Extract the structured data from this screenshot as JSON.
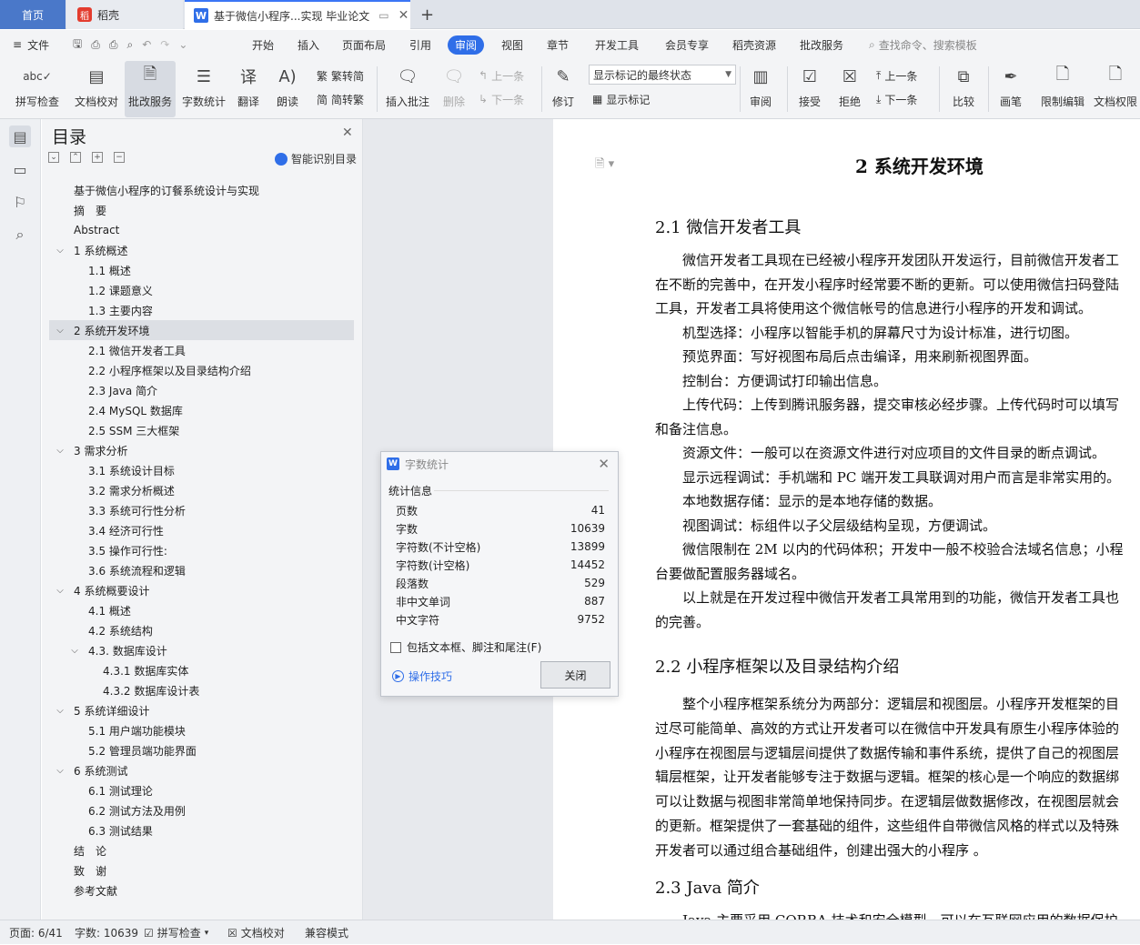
{
  "tabs": {
    "home": "首页",
    "draft": "稻壳",
    "doc": "基于微信小程序...实现 毕业论文",
    "new": "+"
  },
  "menu": {
    "file": "文件",
    "items": [
      "开始",
      "插入",
      "页面布局",
      "引用",
      "审阅",
      "视图",
      "章节",
      "开发工具",
      "会员专享",
      "稻壳资源",
      "批改服务"
    ],
    "active": "审阅",
    "search": "查找命令、搜索模板"
  },
  "ribbon": {
    "spell": "拼写检查",
    "proof": "文档校对",
    "correct": "批改服务",
    "wordcount": "字数统计",
    "translate": "翻译",
    "read": "朗读",
    "trad": "繁转简",
    "simp": "简转繁",
    "insert_comment": "插入批注",
    "delete": "删除",
    "prev": "上一条",
    "next": "下一条",
    "revise": "修订",
    "markup_select": "显示标记的最终状态",
    "show_markup": "显示标记",
    "review": "审阅",
    "accept": "接受",
    "reject": "拒绝",
    "prev2": "上一条",
    "next2": "下一条",
    "compare": "比较",
    "pen": "画笔",
    "restrict": "限制编辑",
    "rights": "文档权限"
  },
  "toc": {
    "title": "目录",
    "smart": "智能识别目录",
    "items": [
      {
        "text": "基于微信小程序的订餐系统设计与实现",
        "level": 0,
        "arrow": ""
      },
      {
        "text": "摘　要",
        "level": 0,
        "arrow": ""
      },
      {
        "text": "Abstract",
        "level": 0,
        "arrow": ""
      },
      {
        "text": "1  系统概述",
        "level": 0,
        "arrow": "v"
      },
      {
        "text": "1.1  概述",
        "level": 1,
        "arrow": ""
      },
      {
        "text": "1.2 课题意义",
        "level": 1,
        "arrow": ""
      },
      {
        "text": "1.3  主要内容",
        "level": 1,
        "arrow": ""
      },
      {
        "text": "2  系统开发环境",
        "level": 0,
        "arrow": "v"
      },
      {
        "text": "2.1 微信开发者工具",
        "level": 1,
        "arrow": ""
      },
      {
        "text": "2.2 小程序框架以及目录结构介绍",
        "level": 1,
        "arrow": ""
      },
      {
        "text": "2.3 Java 简介",
        "level": 1,
        "arrow": ""
      },
      {
        "text": "2.4 MySQL 数据库",
        "level": 1,
        "arrow": ""
      },
      {
        "text": "2.5 SSM 三大框架",
        "level": 1,
        "arrow": ""
      },
      {
        "text": "3  需求分析",
        "level": 0,
        "arrow": "v"
      },
      {
        "text": "3.1  系统设计目标",
        "level": 1,
        "arrow": ""
      },
      {
        "text": "3.2 需求分析概述",
        "level": 1,
        "arrow": ""
      },
      {
        "text": "3.3  系统可行性分析",
        "level": 1,
        "arrow": ""
      },
      {
        "text": "3.4 经济可行性",
        "level": 1,
        "arrow": ""
      },
      {
        "text": "3.5 操作可行性:",
        "level": 1,
        "arrow": ""
      },
      {
        "text": "3.6 系统流程和逻辑",
        "level": 1,
        "arrow": ""
      },
      {
        "text": "4 系统概要设计",
        "level": 0,
        "arrow": "v"
      },
      {
        "text": "4.1  概述",
        "level": 1,
        "arrow": ""
      },
      {
        "text": "4.2  系统结构",
        "level": 1,
        "arrow": ""
      },
      {
        "text": "4.3.  数据库设计",
        "level": 1,
        "arrow": "v"
      },
      {
        "text": "4.3.1  数据库实体",
        "level": 2,
        "arrow": ""
      },
      {
        "text": "4.3.2  数据库设计表",
        "level": 2,
        "arrow": ""
      },
      {
        "text": "5 系统详细设计",
        "level": 0,
        "arrow": "v"
      },
      {
        "text": "5.1 用户端功能模块",
        "level": 1,
        "arrow": ""
      },
      {
        "text": "5.2 管理员端功能界面",
        "level": 1,
        "arrow": ""
      },
      {
        "text": "6  系统测试",
        "level": 0,
        "arrow": "v"
      },
      {
        "text": "6.1  测试理论",
        "level": 1,
        "arrow": ""
      },
      {
        "text": "6.2  测试方法及用例",
        "level": 1,
        "arrow": ""
      },
      {
        "text": "6.3 测试结果",
        "level": 1,
        "arrow": ""
      },
      {
        "text": "结　论",
        "level": 0,
        "arrow": ""
      },
      {
        "text": "致　谢",
        "level": 0,
        "arrow": ""
      },
      {
        "text": "参考文献",
        "level": 0,
        "arrow": ""
      }
    ],
    "selected_index": 7
  },
  "doc": {
    "chapter": "2  系统开发环境",
    "h21": "2.1 微信开发者工具",
    "p": [
      "　　微信开发者工具现在已经被小程序开发团队开发运行，目前微信开发者工",
      "在不断的完善中，在开发小程序时经常要不断的更新。可以使用微信扫码登陆",
      "工具，开发者工具将使用这个微信帐号的信息进行小程序的开发和调试。",
      "　　机型选择：小程序以智能手机的屏幕尺寸为设计标准，进行切图。",
      "　　预览界面：写好视图布局后点击编译，用来刷新视图界面。",
      "　　控制台：方便调试打印输出信息。",
      "　　上传代码：上传到腾讯服务器，提交审核必经步骤。上传代码时可以填写",
      "和备注信息。",
      "　　资源文件：一般可以在资源文件进行对应项目的文件目录的断点调试。",
      "　　显示远程调试：手机端和 PC 端开发工具联调对用户而言是非常实用的。",
      "　　本地数据存储：显示的是本地存储的数据。",
      "　　视图调试：标组件以子父层级结构呈现，方便调试。",
      "　　微信限制在 2M  以内的代码体积；开发中一般不校验合法域名信息；小程",
      "台要做配置服务器域名。",
      "　　以上就是在开发过程中微信开发者工具常用到的功能，微信开发者工具也",
      "的完善。"
    ],
    "h22": "2.2 小程序框架以及目录结构介绍",
    "p2": [
      "　　整个小程序框架系统分为两部分：逻辑层和视图层。小程序开发框架的目",
      "过尽可能简单、高效的方式让开发者可以在微信中开发具有原生小程序体验的",
      "小程序在视图层与逻辑层间提供了数据传输和事件系统，提供了自己的视图层",
      "辑层框架，让开发者能够专注于数据与逻辑。框架的核心是一个响应的数据绑",
      "可以让数据与视图非常简单地保持同步。在逻辑层做数据修改，在视图层就会",
      "的更新。框架提供了一套基础的组件，这些组件自带微信风格的样式以及特殊",
      "开发者可以通过组合基础组件，创建出强大的小程序  。"
    ],
    "h23": "2.3 Java 简介",
    "p3": "　　Java 主要采用 CORBA 技术和安全模型，可以在互联网应用的数据保护"
  },
  "dialog": {
    "title": "字数统计",
    "section": "统计信息",
    "rows": [
      {
        "label": "页数",
        "value": "41"
      },
      {
        "label": "字数",
        "value": "10639"
      },
      {
        "label": "字符数(不计空格)",
        "value": "13899"
      },
      {
        "label": "字符数(计空格)",
        "value": "14452"
      },
      {
        "label": "段落数",
        "value": "529"
      },
      {
        "label": "非中文单词",
        "value": "887"
      },
      {
        "label": "中文字符",
        "value": "9752"
      }
    ],
    "checkbox": "包括文本框、脚注和尾注(F)",
    "tips": "操作技巧",
    "close": "关闭"
  },
  "status": {
    "page": "页面: 6/41",
    "words": "字数: 10639",
    "spell": "拼写检查",
    "proof": "文档校对",
    "compat": "兼容模式"
  }
}
